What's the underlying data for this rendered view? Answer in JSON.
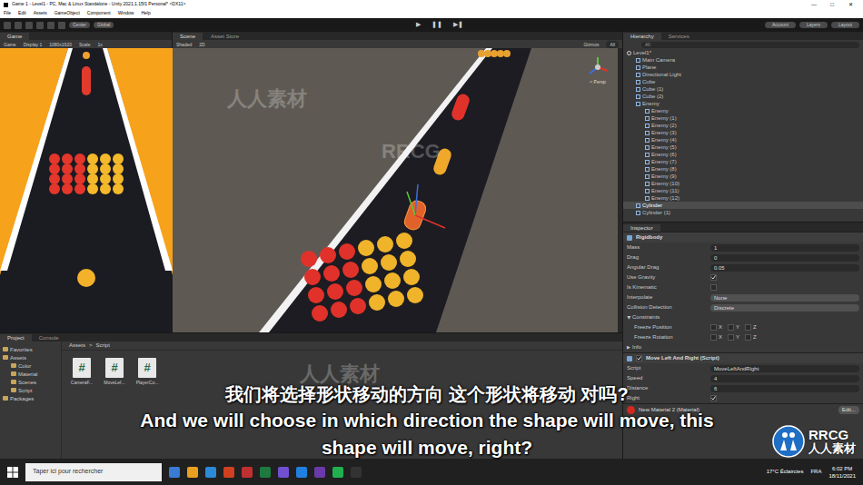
{
  "window": {
    "title": "Game 1 - Level1 - PC, Mac & Linux Standalone - Unity 2021.1.15f1 Personal* <DX11>",
    "controls": [
      "—",
      "□",
      "✕"
    ]
  },
  "menu": [
    "File",
    "Edit",
    "Assets",
    "GameObject",
    "Component",
    "Window",
    "Help"
  ],
  "toolbar": {
    "left": [
      "Center",
      "Global"
    ],
    "right": [
      "Account",
      "Layers",
      "Layout"
    ]
  },
  "game": {
    "tab": "Game",
    "mode": "Game",
    "display": "Display 1",
    "resolution": "1080x1920",
    "scale": "Scale",
    "scale_value": "1x"
  },
  "scene": {
    "tabs": [
      {
        "label": "Scene",
        "selected": true
      },
      {
        "label": "Asset Store",
        "selected": false
      }
    ],
    "shading": "Shaded",
    "mode": "2D",
    "gizmos": "Gizmos",
    "search": "All",
    "persp": "< Persp"
  },
  "hierarchy": {
    "tabs": [
      {
        "label": "Hierarchy",
        "selected": true
      },
      {
        "label": "Services",
        "selected": false
      }
    ],
    "search": "All",
    "items": [
      {
        "label": "Level1*",
        "depth": 0,
        "selected": false
      },
      {
        "label": "Main Camera",
        "depth": 1,
        "selected": false
      },
      {
        "label": "Plane",
        "depth": 1,
        "selected": false
      },
      {
        "label": "Directional Light",
        "depth": 1,
        "selected": false
      },
      {
        "label": "Cube",
        "depth": 1,
        "selected": false
      },
      {
        "label": "Cube (1)",
        "depth": 1,
        "selected": false
      },
      {
        "label": "Cube (2)",
        "depth": 1,
        "selected": false
      },
      {
        "label": "Enemy",
        "depth": 1,
        "selected": false
      },
      {
        "label": "Enemy",
        "depth": 2,
        "selected": false
      },
      {
        "label": "Enemy (1)",
        "depth": 2,
        "selected": false
      },
      {
        "label": "Enemy (2)",
        "depth": 2,
        "selected": false
      },
      {
        "label": "Enemy (3)",
        "depth": 2,
        "selected": false
      },
      {
        "label": "Enemy (4)",
        "depth": 2,
        "selected": false
      },
      {
        "label": "Enemy (5)",
        "depth": 2,
        "selected": false
      },
      {
        "label": "Enemy (6)",
        "depth": 2,
        "selected": false
      },
      {
        "label": "Enemy (7)",
        "depth": 2,
        "selected": false
      },
      {
        "label": "Enemy (8)",
        "depth": 2,
        "selected": false
      },
      {
        "label": "Enemy (9)",
        "depth": 2,
        "selected": false
      },
      {
        "label": "Enemy (10)",
        "depth": 2,
        "selected": false
      },
      {
        "label": "Enemy (11)",
        "depth": 2,
        "selected": false
      },
      {
        "label": "Enemy (12)",
        "depth": 2,
        "selected": false
      },
      {
        "label": "Cylinder",
        "depth": 1,
        "selected": true
      },
      {
        "label": "Cylinder (1)",
        "depth": 1,
        "selected": false
      }
    ]
  },
  "inspector": {
    "tab": "Inspector",
    "rows": [
      {
        "kind": "header",
        "label": "Rigidbody"
      },
      {
        "kind": "field",
        "label": "Mass",
        "value": "1"
      },
      {
        "kind": "field",
        "label": "Drag",
        "value": "0"
      },
      {
        "kind": "field",
        "label": "Angular Drag",
        "value": "0.05"
      },
      {
        "kind": "checkbox",
        "label": "Use Gravity",
        "checked": true
      },
      {
        "kind": "checkbox",
        "label": "Is Kinematic",
        "checked": false
      },
      {
        "kind": "dropdown",
        "label": "Interpolate",
        "value": "None"
      },
      {
        "kind": "dropdown",
        "label": "Collision Detection",
        "value": "Discrete"
      },
      {
        "kind": "foldout",
        "label": "Constraints",
        "expanded": true
      },
      {
        "kind": "xyz",
        "label": "Freeze Position",
        "axes": [
          {
            "label": "X",
            "checked": false
          },
          {
            "label": "Y",
            "checked": false
          },
          {
            "label": "Z",
            "checked": false
          }
        ]
      },
      {
        "kind": "xyz",
        "label": "Freeze Rotation",
        "axes": [
          {
            "label": "X",
            "checked": false
          },
          {
            "label": "Y",
            "checked": false
          },
          {
            "label": "Z",
            "checked": false
          }
        ]
      },
      {
        "kind": "foldout",
        "label": "Info",
        "expanded": false
      },
      {
        "kind": "header",
        "label": "Move Left And Right (Script)",
        "enabled": true
      },
      {
        "kind": "field",
        "label": "Script",
        "value": "MoveLeftAndRight"
      },
      {
        "kind": "field",
        "label": "Speed",
        "value": "4"
      },
      {
        "kind": "field",
        "label": "Distance",
        "value": "6"
      },
      {
        "kind": "checkbox",
        "label": "Right",
        "checked": true
      },
      {
        "kind": "material",
        "label": "New Material 2 (Material)",
        "value": "Edit..."
      }
    ]
  },
  "project": {
    "tabs": [
      {
        "label": "Project",
        "selected": true
      },
      {
        "label": "Console",
        "selected": false
      }
    ],
    "tree": [
      {
        "label": "Favorites",
        "depth": 0
      },
      {
        "label": "Assets",
        "depth": 0
      },
      {
        "label": "Color",
        "depth": 1
      },
      {
        "label": "Material",
        "depth": 1
      },
      {
        "label": "Scenes",
        "depth": 1
      },
      {
        "label": "Script",
        "depth": 1
      },
      {
        "label": "Packages",
        "depth": 0
      }
    ],
    "breadcrumb": [
      "Assets",
      ">",
      "Script"
    ],
    "files": [
      {
        "label": "CameraF...",
        "glyph": "#"
      },
      {
        "label": "MoveLef...",
        "glyph": "#"
      },
      {
        "label": "PlayerCo...",
        "glyph": "#"
      }
    ]
  },
  "taskbar": {
    "search": "Taper ici pour rechercher",
    "weather": "17°C Éclaircies",
    "lang": "FRA",
    "time": "6:02 PM",
    "date": "18/11/2021"
  },
  "subtitles": {
    "zh": "我们将选择形状移动的方向 这个形状将移动 对吗?",
    "en": "And we will choose in which direction the shape will move, this shape will move, right?"
  },
  "watermarks": [
    "人人素材",
    "RRCG",
    "人人素材"
  ],
  "logo": {
    "mark": "RRCG",
    "name": "人人素材"
  }
}
